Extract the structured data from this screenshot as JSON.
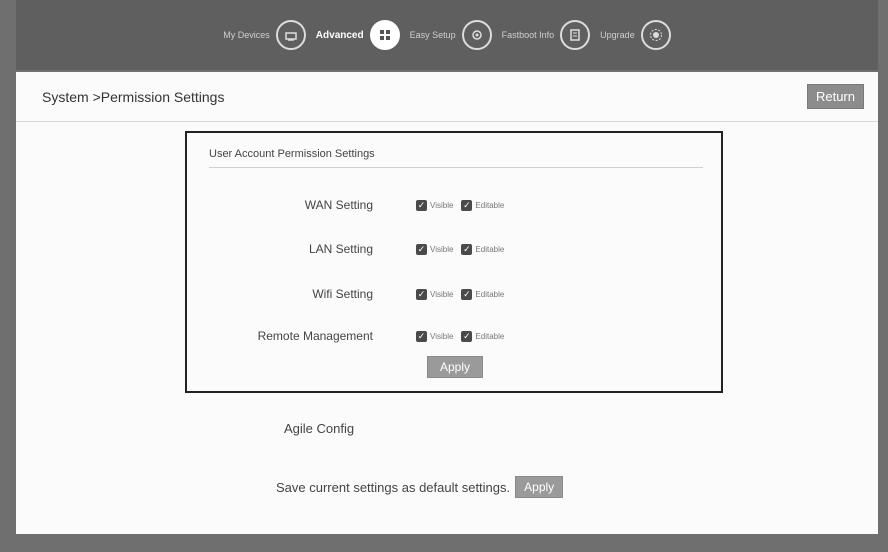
{
  "nav": {
    "items": [
      {
        "label": "My Devices",
        "icon": "devices-icon",
        "active": false
      },
      {
        "label": "Advanced",
        "icon": "advanced-icon",
        "active": true
      },
      {
        "label": "Easy Setup",
        "icon": "setup-icon",
        "active": false
      },
      {
        "label": "Fastboot Info",
        "icon": "info-icon",
        "active": false
      },
      {
        "label": "Upgrade",
        "icon": "upgrade-icon",
        "active": false
      }
    ]
  },
  "header": {
    "breadcrumb": "System >Permission Settings",
    "return_label": "Return"
  },
  "permissions": {
    "title": "User Account Permission Settings",
    "visible_label": "Visible",
    "editable_label": "Editable",
    "rows": [
      {
        "label": "WAN Setting",
        "visible": true,
        "editable": true
      },
      {
        "label": "LAN Setting",
        "visible": true,
        "editable": true
      },
      {
        "label": "Wifi Setting",
        "visible": true,
        "editable": true
      },
      {
        "label": "Remote Management",
        "visible": true,
        "editable": true
      }
    ],
    "apply_label": "Apply"
  },
  "agile": {
    "label": "Agile Config"
  },
  "defaults": {
    "text": "Save current settings as default settings.",
    "apply_label": "Apply"
  }
}
